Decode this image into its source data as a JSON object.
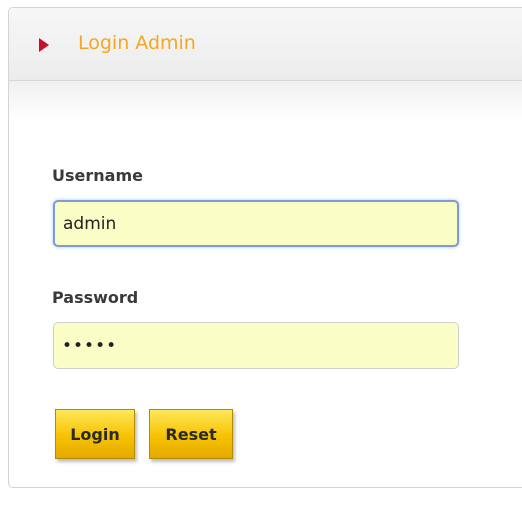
{
  "panel": {
    "title": "Login Admin",
    "title_icon": "arrow-right-icon",
    "accent_color": "#f5a623",
    "icon_color": "#c8102e"
  },
  "form": {
    "username": {
      "label": "Username",
      "value": "admin"
    },
    "password": {
      "label": "Password",
      "value": "•••••"
    },
    "login_label": "Login",
    "reset_label": "Reset",
    "button_color": "#f6c200",
    "field_color": "#fbfdc6"
  }
}
